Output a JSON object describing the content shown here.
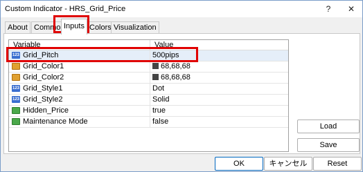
{
  "window": {
    "title": "Custom Indicator - HRS_Grid_Price",
    "help": "?",
    "close": "✕"
  },
  "tabs": [
    "About",
    "Common",
    "Inputs",
    "Colors",
    "Visualization"
  ],
  "grid": {
    "headers": {
      "variable": "Variable",
      "value": "Value"
    },
    "rows": [
      {
        "icon": "int-icon",
        "name": "Grid_Pitch",
        "value": "500pips"
      },
      {
        "icon": "color-icon",
        "name": "Grid_Color1",
        "value": "68,68,68"
      },
      {
        "icon": "color-icon",
        "name": "Grid_Color2",
        "value": "68,68,68"
      },
      {
        "icon": "int-icon",
        "name": "Grid_Style1",
        "value": "Dot"
      },
      {
        "icon": "int-icon",
        "name": "Grid_Style2",
        "value": "Solid"
      },
      {
        "icon": "bool-icon",
        "name": "Hidden_Price",
        "value": "true"
      },
      {
        "icon": "bool-icon",
        "name": "Maintenance Mode",
        "value": "false"
      }
    ],
    "swatch_color": "#444444",
    "int_icon_text": "123"
  },
  "side_buttons": {
    "load": "Load",
    "save": "Save"
  },
  "bottom_buttons": {
    "ok": "OK",
    "cancel": "キャンセル",
    "reset": "Reset"
  },
  "highlight_color": "#e00000"
}
